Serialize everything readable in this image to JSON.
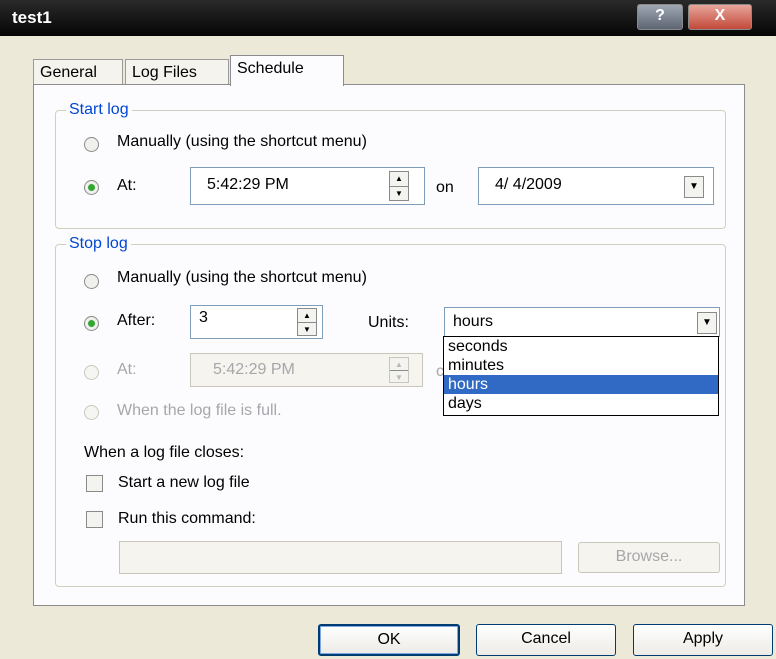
{
  "window": {
    "title": "test1",
    "help_label": "?",
    "close_label": "X"
  },
  "tabs": [
    {
      "label": "General"
    },
    {
      "label": "Log Files"
    },
    {
      "label": "Schedule"
    }
  ],
  "start_log": {
    "legend": "Start log",
    "manual_label": "Manually (using the shortcut menu)",
    "at_label": "At:",
    "time": "5:42:29 PM",
    "on_label": "on",
    "date": "4/ 4/2009"
  },
  "stop_log": {
    "legend": "Stop log",
    "manual_label": "Manually (using the shortcut menu)",
    "after_label": "After:",
    "after_value": "3",
    "units_label": "Units:",
    "units_value": "hours",
    "units_options": [
      "seconds",
      "minutes",
      "hours",
      "days"
    ],
    "at_label": "At:",
    "at_time": "5:42:29 PM",
    "at_on_partial": "c",
    "full_label": "When the log file is full."
  },
  "close_actions": {
    "heading": "When a log file closes:",
    "new_log_label": "Start a new log file",
    "run_command_label": "Run this command:",
    "command_value": "",
    "browse_label": "Browse..."
  },
  "footer": {
    "ok": "OK",
    "cancel": "Cancel",
    "apply": "Apply"
  }
}
